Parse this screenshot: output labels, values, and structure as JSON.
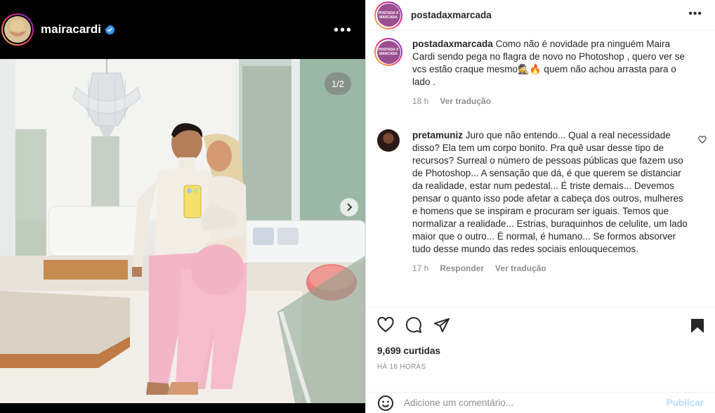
{
  "media": {
    "username": "mairacardi",
    "verified": true,
    "more_icon": "more-horizontal-icon",
    "counter": "1/2",
    "next_icon": "chevron-right-icon"
  },
  "panel": {
    "username": "postadaxmarcada",
    "logo_text": "POSTADA X MARCADA",
    "more_icon": "more-horizontal-icon"
  },
  "caption": {
    "user": "postadaxmarcada",
    "text": "Como não é novidade pra ninguém Maira Cardi sendo pega no flagra de novo no Photoshop , quero ver se vcs estão craque mesmo🕵️🔥 quem não achou arrasta para o lado .",
    "time": "18 h",
    "translate": "Ver tradução"
  },
  "comment": {
    "user": "pretamuniz",
    "text": "Juro que não entendo... Qual a real necessidade disso? Ela tem um corpo bonito. Pra quê usar desse tipo de recursos? Surreal o número de pessoas públicas que fazem uso de Photoshop... A sensação que dá, é que querem se distanciar da realidade, estar num pedestal... É triste demais... Devemos pensar o quanto isso pode afetar a cabeça dos outros, mulheres e homens que se inspiram e procuram ser iguais. Temos que normalizar a realidade... Estrias, buraquinhos de celulite, um lado maior que o outro... É normal, é humano... Se formos absorver tudo desse mundo das redes sociais enlouquecemos.",
    "time": "17 h",
    "reply": "Responder",
    "translate": "Ver tradução"
  },
  "actions": {
    "like_icon": "heart-icon",
    "comment_icon": "comment-icon",
    "share_icon": "send-icon",
    "save_icon": "bookmark-icon"
  },
  "likes": "9,699 curtidas",
  "date": "HÁ 18 HORAS",
  "add_comment": {
    "emoji_icon": "emoji-icon",
    "placeholder": "Adicione um comentário...",
    "publish": "Publicar"
  },
  "colors": {
    "verified": "#3897f0",
    "publish_disabled": "#b2dffc",
    "muted": "#8e8e8e",
    "sweatsuit_pink": "#f2b6c8"
  }
}
